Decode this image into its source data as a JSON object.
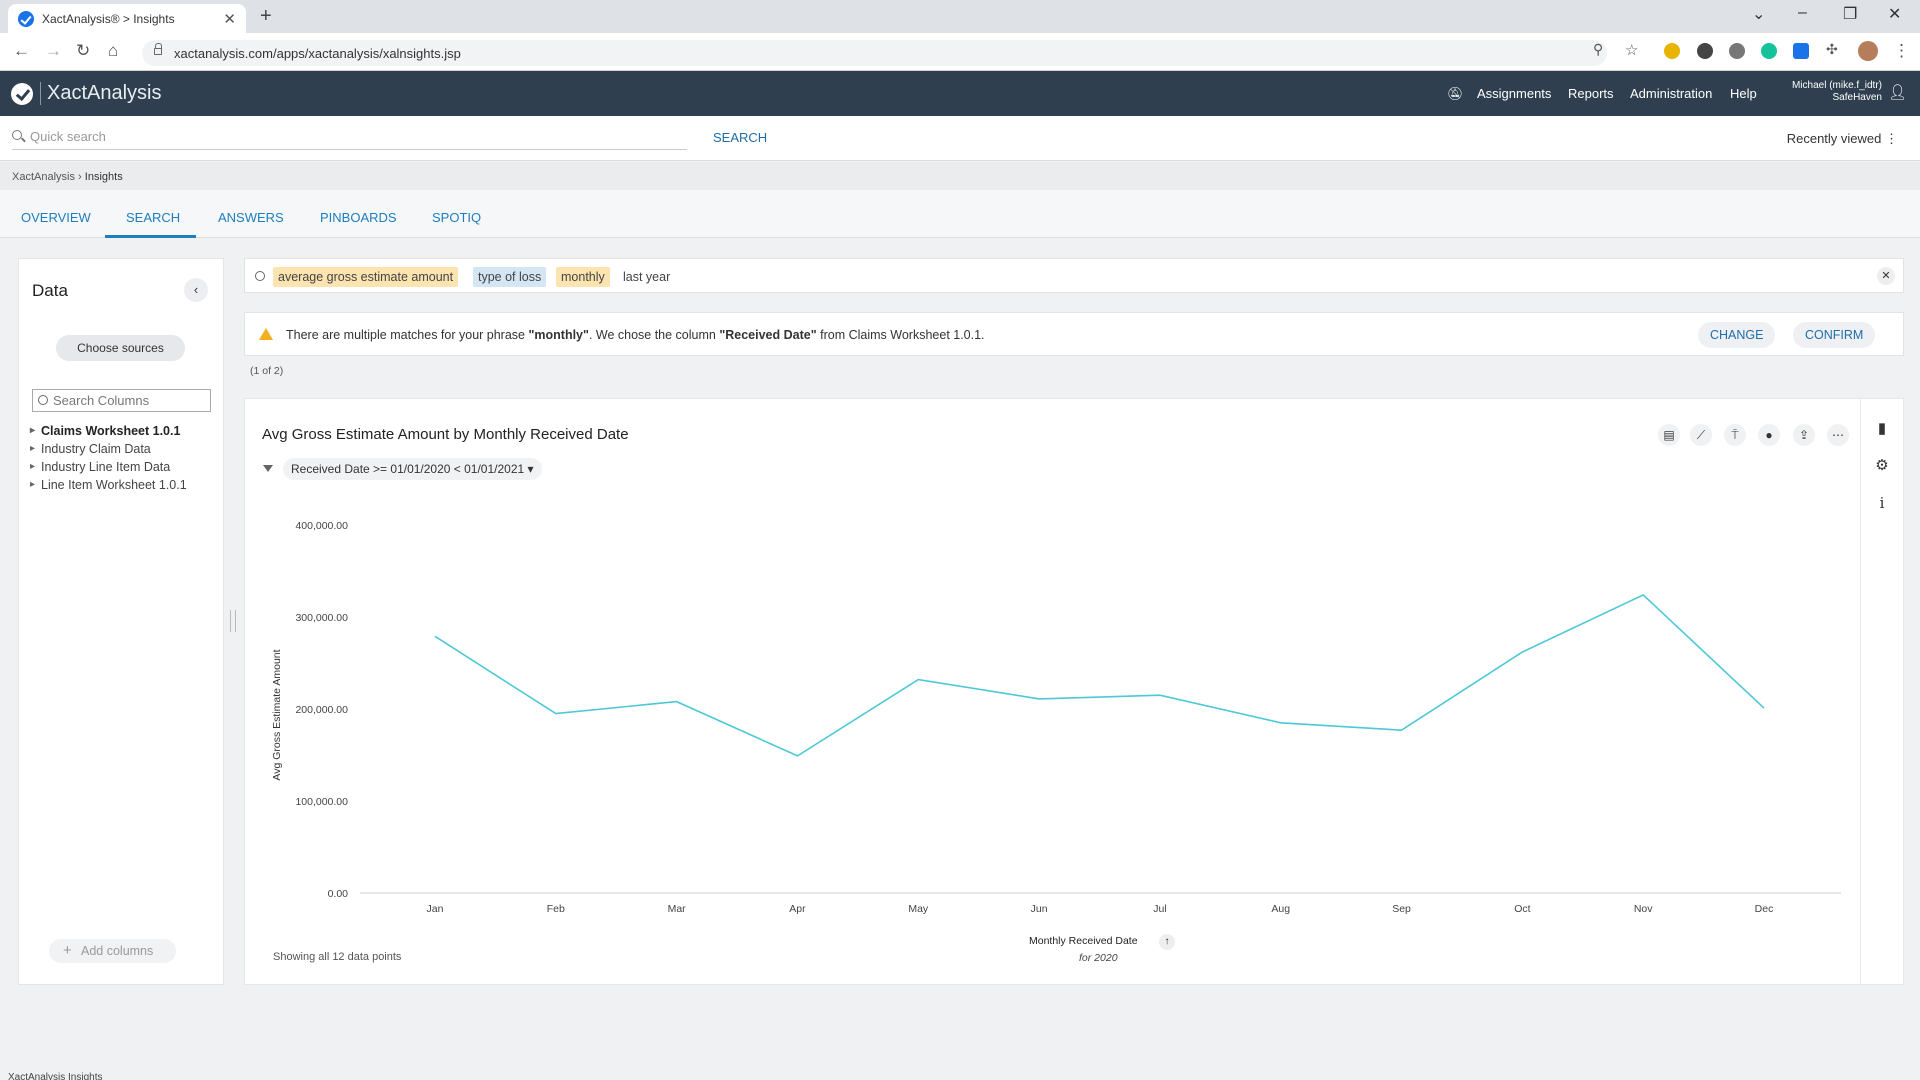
{
  "browser": {
    "tab_title": "XactAnalysis® > Insights",
    "url": "xactanalysis.com/apps/xactanalysis/xalnsights.jsp"
  },
  "header": {
    "brand": "XactAnalysis",
    "nav": [
      "Assignments",
      "Reports",
      "Administration",
      "Help"
    ],
    "user_name": "Michael (mike.f_idtr)",
    "user_company": "SafeHaven"
  },
  "quicksearch": {
    "placeholder": "Quick search",
    "button": "SEARCH",
    "recent": "Recently viewed ⋮"
  },
  "breadcrumb": [
    "XactAnalysis",
    "Insights"
  ],
  "tabs": [
    "OVERVIEW",
    "SEARCH",
    "ANSWERS",
    "PINBOARDS",
    "SPOTIQ"
  ],
  "data_panel": {
    "title": "Data",
    "choose_sources": "Choose sources",
    "search_placeholder": "Search Columns",
    "sources": [
      "Claims Worksheet 1.0.1",
      "Industry Claim Data",
      "Industry Line Item Data",
      "Line Item Worksheet 1.0.1"
    ],
    "add_columns": "Add columns"
  },
  "search_tokens": [
    "average gross estimate amount",
    "type of loss",
    "monthly",
    "last year"
  ],
  "warning": {
    "pre": "There are multiple matches for your phrase ",
    "phrase": "\"monthly\"",
    "mid": ". We chose the column ",
    "column": "\"Received Date\"",
    "post": " from Claims Worksheet 1.0.1.",
    "change": "CHANGE",
    "confirm": "CONFIRM",
    "page_count": "(1 of 2)"
  },
  "chart_card": {
    "filter": "Received Date >= 01/01/2020 < 01/01/2021",
    "points_note": "Showing all 12 data points",
    "x_name": "Monthly Received Date",
    "x_sub": "for 2020"
  },
  "chart_data": {
    "type": "line",
    "title": "Avg Gross Estimate Amount by Monthly Received Date",
    "xlabel": "Monthly Received Date",
    "ylabel": "Avg Gross Estimate Amount",
    "categories": [
      "Jan",
      "Feb",
      "Mar",
      "Apr",
      "May",
      "Jun",
      "Jul",
      "Aug",
      "Sep",
      "Oct",
      "Nov",
      "Dec"
    ],
    "values": [
      279000,
      195000,
      208000,
      149000,
      232000,
      211000,
      215000,
      185000,
      177000,
      262000,
      324000,
      201000
    ],
    "yticks": [
      "400,000.00",
      "300,000.00",
      "200,000.00",
      "100,000.00",
      "0.00"
    ],
    "ylim": [
      0,
      400000
    ],
    "line_color": "#4cc8d6",
    "grid": false
  },
  "status_text": "XactAnalysis Insights"
}
